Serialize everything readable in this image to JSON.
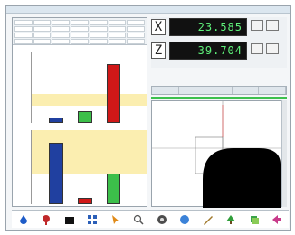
{
  "window": {
    "title": ""
  },
  "dro": {
    "axes": [
      {
        "label": "X",
        "value": "23.585"
      },
      {
        "label": "Z",
        "value": "39.704"
      }
    ]
  },
  "chart_data": [
    {
      "type": "bar",
      "series": [
        {
          "values": [
            1,
            2,
            10
          ]
        }
      ],
      "colors": [
        "#2040a0",
        "#3cbf4a",
        "#d01818"
      ],
      "band": [
        3,
        5
      ],
      "ylim": [
        0,
        12
      ]
    },
    {
      "type": "bar",
      "series": [
        {
          "values": [
            10,
            1,
            5
          ]
        }
      ],
      "colors": [
        "#2040a0",
        "#d01818",
        "#3cbf4a"
      ],
      "band": [
        5,
        12
      ],
      "ylim": [
        0,
        12
      ]
    }
  ],
  "toolbar": {
    "icons": [
      "water-drop-icon",
      "pin-icon",
      "folder-icon",
      "grid-icon",
      "pointer-icon",
      "zoom-icon",
      "measure-icon",
      "info-icon",
      "tool-icon",
      "tree-icon",
      "layers-icon",
      "arrow-icon"
    ]
  }
}
